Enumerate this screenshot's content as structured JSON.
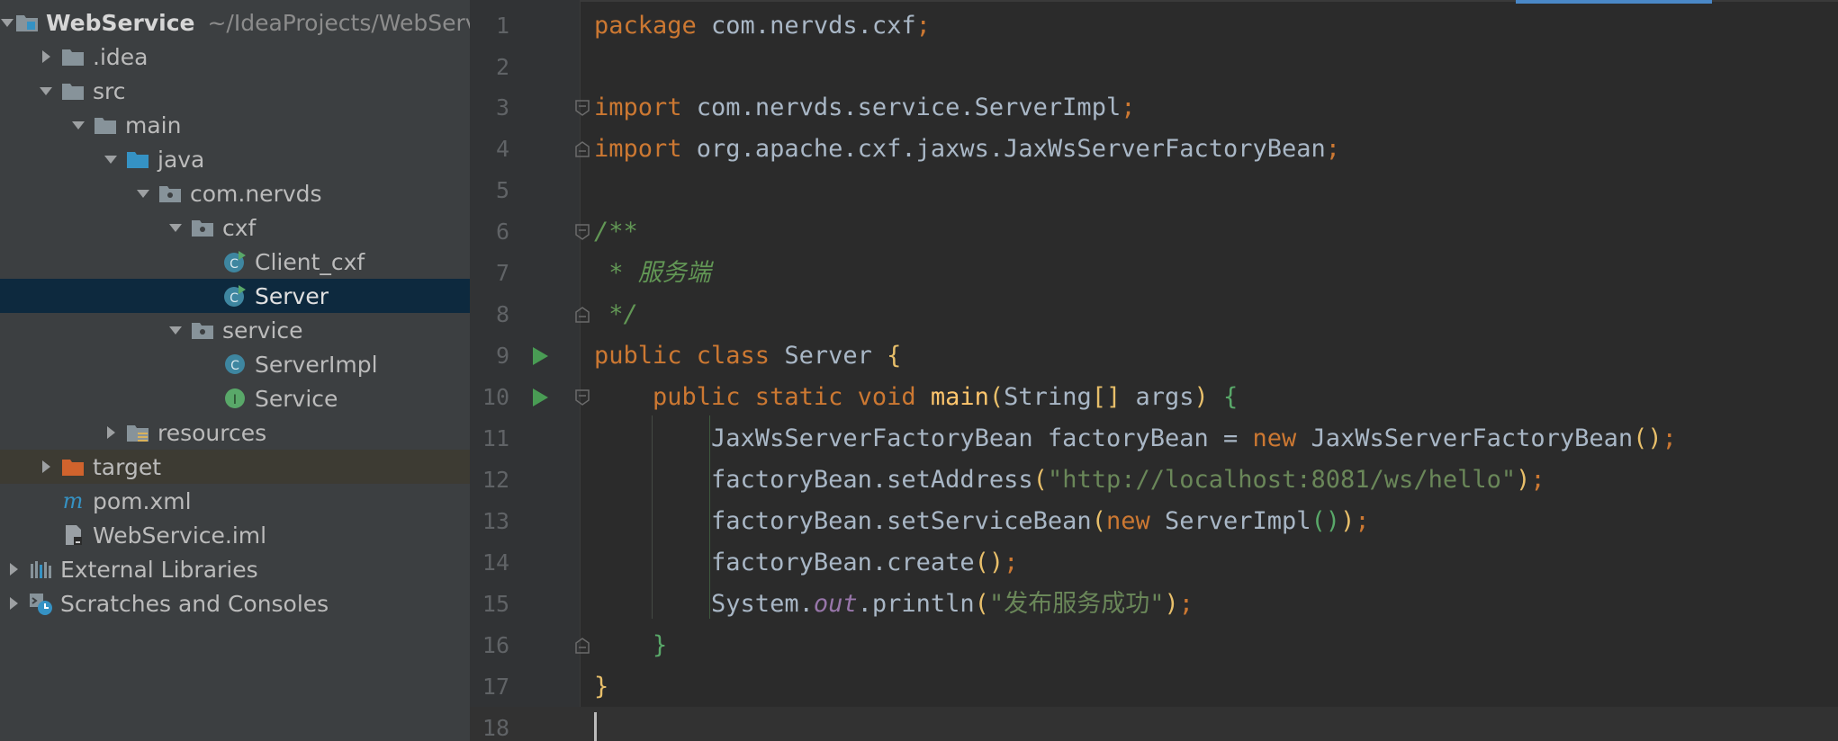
{
  "project_tree": {
    "root": {
      "label": "WebService",
      "path": "~/IdeaProjects/WebService"
    },
    "items": [
      {
        "label": ".idea"
      },
      {
        "label": "src"
      },
      {
        "label": "main"
      },
      {
        "label": "java"
      },
      {
        "label": "com.nervds"
      },
      {
        "label": "cxf"
      },
      {
        "label": "Client_cxf"
      },
      {
        "label": "Server"
      },
      {
        "label": "service"
      },
      {
        "label": "ServerImpl"
      },
      {
        "label": "Service"
      },
      {
        "label": "resources"
      },
      {
        "label": "target"
      },
      {
        "label": "pom.xml"
      },
      {
        "label": "WebService.iml"
      },
      {
        "label": "External Libraries"
      },
      {
        "label": "Scratches and Consoles"
      }
    ]
  },
  "editor": {
    "line_numbers": [
      "1",
      "2",
      "3",
      "4",
      "5",
      "6",
      "7",
      "8",
      "9",
      "10",
      "11",
      "12",
      "13",
      "14",
      "15",
      "16",
      "17",
      "18"
    ],
    "lines": [
      [
        {
          "t": "package ",
          "c": "kw"
        },
        {
          "t": "com.nervds.cxf",
          "c": "pl"
        },
        {
          "t": ";",
          "c": "kw"
        }
      ],
      [],
      [
        {
          "t": "import ",
          "c": "kw"
        },
        {
          "t": "com.nervds.service.ServerImpl",
          "c": "pl"
        },
        {
          "t": ";",
          "c": "kw"
        }
      ],
      [
        {
          "t": "import ",
          "c": "kw"
        },
        {
          "t": "org.apache.cxf.jaxws.JaxWsServerFactoryBean",
          "c": "pl"
        },
        {
          "t": ";",
          "c": "kw"
        }
      ],
      [],
      [
        {
          "t": "/**",
          "c": "cm"
        }
      ],
      [
        {
          "t": " * 服务端",
          "c": "cm"
        }
      ],
      [
        {
          "t": " */",
          "c": "cm"
        }
      ],
      [
        {
          "t": "public class ",
          "c": "kw"
        },
        {
          "t": "Server ",
          "c": "pl"
        },
        {
          "t": "{",
          "c": "by"
        }
      ],
      [
        {
          "t": "    public static void ",
          "c": "kw"
        },
        {
          "t": "main",
          "c": "fn"
        },
        {
          "t": "(",
          "c": "by"
        },
        {
          "t": "String",
          "c": "pl"
        },
        {
          "t": "[]",
          "c": "by"
        },
        {
          "t": " args",
          "c": "pl"
        },
        {
          "t": ") ",
          "c": "by"
        },
        {
          "t": "{",
          "c": "bg"
        }
      ],
      [
        {
          "t": "        JaxWsServerFactoryBean factoryBean = ",
          "c": "pl"
        },
        {
          "t": "new ",
          "c": "kw"
        },
        {
          "t": "JaxWsServerFactoryBean",
          "c": "pl"
        },
        {
          "t": "()",
          "c": "by"
        },
        {
          "t": ";",
          "c": "kw"
        }
      ],
      [
        {
          "t": "        factoryBean.setAddress",
          "c": "pl"
        },
        {
          "t": "(",
          "c": "by"
        },
        {
          "t": "\"http://localhost:8081/ws/hello\"",
          "c": "str"
        },
        {
          "t": ")",
          "c": "by"
        },
        {
          "t": ";",
          "c": "kw"
        }
      ],
      [
        {
          "t": "        factoryBean.setServiceBean",
          "c": "pl"
        },
        {
          "t": "(",
          "c": "by"
        },
        {
          "t": "new ",
          "c": "kw"
        },
        {
          "t": "ServerImpl",
          "c": "pl"
        },
        {
          "t": "()",
          "c": "bg"
        },
        {
          "t": ")",
          "c": "by"
        },
        {
          "t": ";",
          "c": "kw"
        }
      ],
      [
        {
          "t": "        factoryBean.create",
          "c": "pl"
        },
        {
          "t": "()",
          "c": "by"
        },
        {
          "t": ";",
          "c": "kw"
        }
      ],
      [
        {
          "t": "        System.",
          "c": "pl"
        },
        {
          "t": "out",
          "c": "st"
        },
        {
          "t": ".println",
          "c": "pl"
        },
        {
          "t": "(",
          "c": "by"
        },
        {
          "t": "\"发布服务成功\"",
          "c": "str"
        },
        {
          "t": ")",
          "c": "by"
        },
        {
          "t": ";",
          "c": "kw"
        }
      ],
      [
        {
          "t": "    }",
          "c": "bg"
        }
      ],
      [
        {
          "t": "}",
          "c": "by"
        }
      ],
      []
    ]
  },
  "colors": {
    "tree_bg": "#3c3f41",
    "editor_bg": "#2b2b2b",
    "selection": "#0d293e",
    "keyword": "#cc7832",
    "string": "#6a8759",
    "comment": "#629755",
    "method": "#ffc66d",
    "static_field": "#9876aa"
  }
}
